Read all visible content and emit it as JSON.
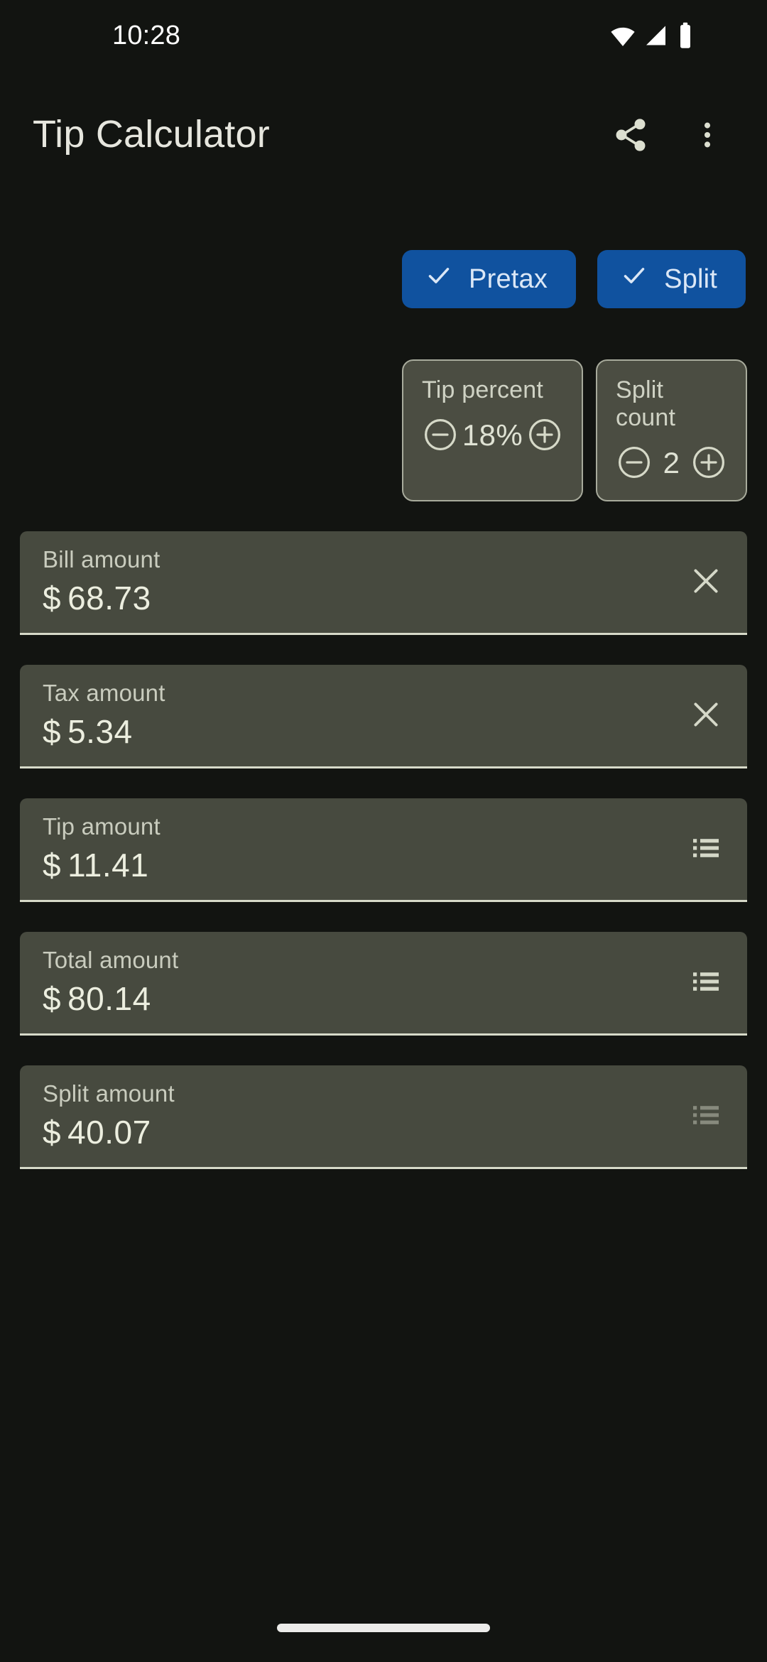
{
  "status_bar": {
    "time": "10:28",
    "icons": [
      "wifi-icon",
      "cellular-signal-icon",
      "battery-icon"
    ]
  },
  "app_bar": {
    "title": "Tip Calculator",
    "share_icon": "share-icon",
    "overflow_icon": "more-vertical-icon"
  },
  "chips": [
    {
      "label": "Pretax",
      "selected": true,
      "icon": "check-icon",
      "color": "#10529f"
    },
    {
      "label": "Split",
      "selected": true,
      "icon": "check-icon",
      "color": "#10529f"
    }
  ],
  "steppers": [
    {
      "label": "Tip percent",
      "value": "18%",
      "decrement_icon": "minus-circle-icon",
      "increment_icon": "plus-circle-icon"
    },
    {
      "label": "Split count",
      "value": "2",
      "decrement_icon": "minus-circle-icon",
      "increment_icon": "plus-circle-icon"
    }
  ],
  "fields": [
    {
      "label": "Bill amount",
      "currency": "$",
      "value": "68.73",
      "action_icon": "close-icon",
      "dimmed": false
    },
    {
      "label": "Tax amount",
      "currency": "$",
      "value": "5.34",
      "action_icon": "close-icon",
      "dimmed": false
    },
    {
      "label": "Tip amount",
      "currency": "$",
      "value": "11.41",
      "action_icon": "list-icon",
      "dimmed": false
    },
    {
      "label": "Total amount",
      "currency": "$",
      "value": "80.14",
      "action_icon": "list-icon",
      "dimmed": false
    },
    {
      "label": "Split amount",
      "currency": "$",
      "value": "40.07",
      "action_icon": "list-icon",
      "dimmed": true
    }
  ],
  "theme": {
    "background": "#121411",
    "surface": "#474a3f",
    "accent": "#10529f",
    "on_surface": "#eceedf",
    "outline": "#a8ab9c"
  }
}
